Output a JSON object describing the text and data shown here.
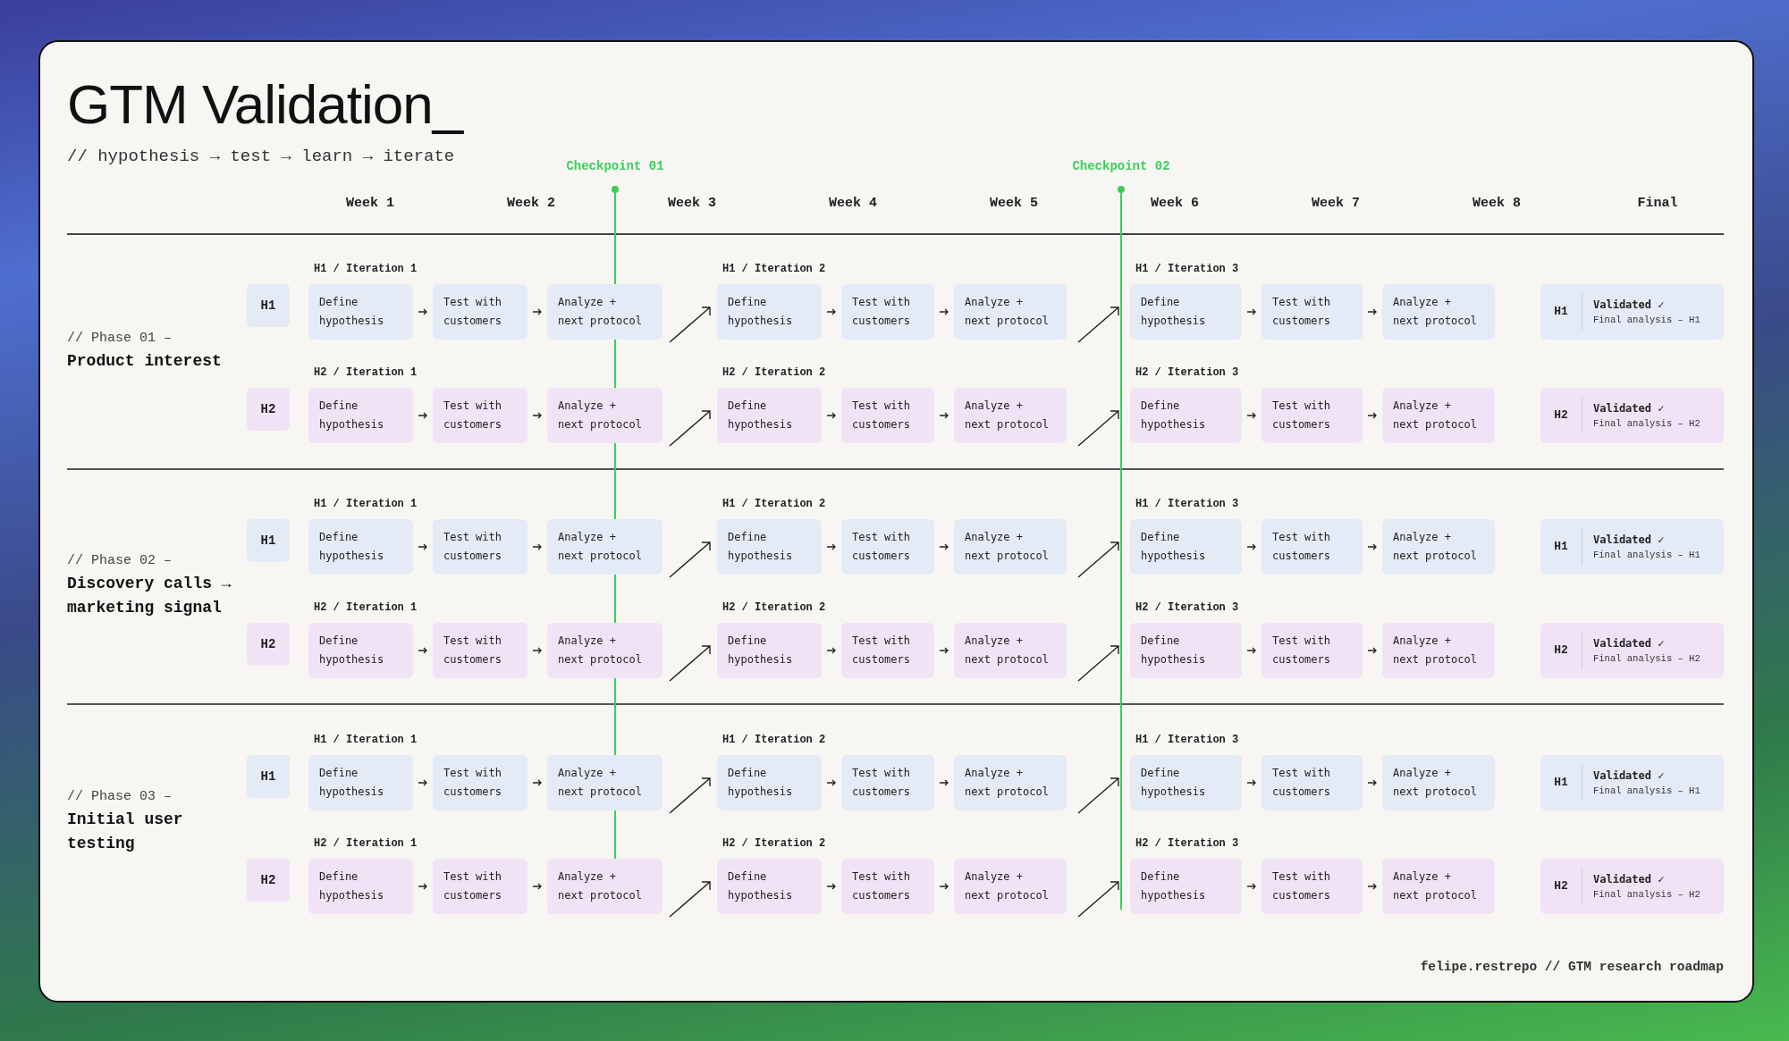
{
  "title": "GTM Validation_",
  "subtitle": "// hypothesis → test → learn → iterate",
  "checkpoints": [
    "Checkpoint 01",
    "Checkpoint 02"
  ],
  "weeks": [
    "Week 1",
    "Week 2",
    "Week 3",
    "Week 4",
    "Week 5",
    "Week 6",
    "Week 7",
    "Week 8",
    "Final"
  ],
  "phases": [
    {
      "prefix": "// Phase 01 –",
      "title": "Product interest",
      "rows": [
        {
          "badge": "H1",
          "color": "#e4ebf6",
          "iterations": [
            {
              "label": "H1 / Iteration 1",
              "steps": [
                "Define\nhypothesis",
                "Test with\ncustomers",
                "Analyze +\nnext protocol"
              ]
            },
            {
              "label": "H1 / Iteration 2",
              "steps": [
                "Define\nhypothesis",
                "Test with\ncustomers",
                "Analyze +\nnext protocol"
              ]
            },
            {
              "label": "H1 / Iteration 3",
              "steps": [
                "Define\nhypothesis",
                "Test with\ncustomers",
                "Analyze +\nnext protocol"
              ]
            }
          ],
          "final": {
            "badge": "H1",
            "status": "Validated ✓",
            "note": "Final analysis – H1"
          }
        },
        {
          "badge": "H2",
          "color": "#f1e3f6",
          "iterations": [
            {
              "label": "H2 / Iteration 1",
              "steps": [
                "Define\nhypothesis",
                "Test with\ncustomers",
                "Analyze +\nnext protocol"
              ]
            },
            {
              "label": "H2 / Iteration 2",
              "steps": [
                "Define\nhypothesis",
                "Test with\ncustomers",
                "Analyze +\nnext protocol"
              ]
            },
            {
              "label": "H2 / Iteration 3",
              "steps": [
                "Define\nhypothesis",
                "Test with\ncustomers",
                "Analyze +\nnext protocol"
              ]
            }
          ],
          "final": {
            "badge": "H2",
            "status": "Validated ✓",
            "note": "Final analysis – H2"
          }
        }
      ]
    },
    {
      "prefix": "// Phase 02 –",
      "title": "Discovery calls → marketing signal",
      "rows": [
        {
          "badge": "H1",
          "color": "#e4ebf6",
          "iterations": [
            {
              "label": "H1 / Iteration 1",
              "steps": [
                "Define\nhypothesis",
                "Test with\ncustomers",
                "Analyze +\nnext protocol"
              ]
            },
            {
              "label": "H1 / Iteration 2",
              "steps": [
                "Define\nhypothesis",
                "Test with\ncustomers",
                "Analyze +\nnext protocol"
              ]
            },
            {
              "label": "H1 / Iteration 3",
              "steps": [
                "Define\nhypothesis",
                "Test with\ncustomers",
                "Analyze +\nnext protocol"
              ]
            }
          ],
          "final": {
            "badge": "H1",
            "status": "Validated ✓",
            "note": "Final analysis – H1"
          }
        },
        {
          "badge": "H2",
          "color": "#f1e3f6",
          "iterations": [
            {
              "label": "H2 / Iteration 1",
              "steps": [
                "Define\nhypothesis",
                "Test with\ncustomers",
                "Analyze +\nnext protocol"
              ]
            },
            {
              "label": "H2 / Iteration 2",
              "steps": [
                "Define\nhypothesis",
                "Test with\ncustomers",
                "Analyze +\nnext protocol"
              ]
            },
            {
              "label": "H2 / Iteration 3",
              "steps": [
                "Define\nhypothesis",
                "Test with\ncustomers",
                "Analyze +\nnext protocol"
              ]
            }
          ],
          "final": {
            "badge": "H2",
            "status": "Validated ✓",
            "note": "Final analysis – H2"
          }
        }
      ]
    },
    {
      "prefix": "// Phase 03 –",
      "title": "Initial user testing",
      "rows": [
        {
          "badge": "H1",
          "color": "#e4ebf6",
          "iterations": [
            {
              "label": "H1 / Iteration 1",
              "steps": [
                "Define\nhypothesis",
                "Test with\ncustomers",
                "Analyze +\nnext protocol"
              ]
            },
            {
              "label": "H1 / Iteration 2",
              "steps": [
                "Define\nhypothesis",
                "Test with\ncustomers",
                "Analyze +\nnext protocol"
              ]
            },
            {
              "label": "H1 / Iteration 3",
              "steps": [
                "Define\nhypothesis",
                "Test with\ncustomers",
                "Analyze +\nnext protocol"
              ]
            }
          ],
          "final": {
            "badge": "H1",
            "status": "Validated ✓",
            "note": "Final analysis – H1"
          }
        },
        {
          "badge": "H2",
          "color": "#f1e3f6",
          "iterations": [
            {
              "label": "H2 / Iteration 1",
              "steps": [
                "Define\nhypothesis",
                "Test with\ncustomers",
                "Analyze +\nnext protocol"
              ]
            },
            {
              "label": "H2 / Iteration 2",
              "steps": [
                "Define\nhypothesis",
                "Test with\ncustomers",
                "Analyze +\nnext protocol"
              ]
            },
            {
              "label": "H2 / Iteration 3",
              "steps": [
                "Define\nhypothesis",
                "Test with\ncustomers",
                "Analyze +\nnext protocol"
              ]
            }
          ],
          "final": {
            "badge": "H2",
            "status": "Validated ✓",
            "note": "Final analysis – H2"
          }
        }
      ]
    }
  ],
  "footer": "felipe.restrepo // GTM research roadmap"
}
